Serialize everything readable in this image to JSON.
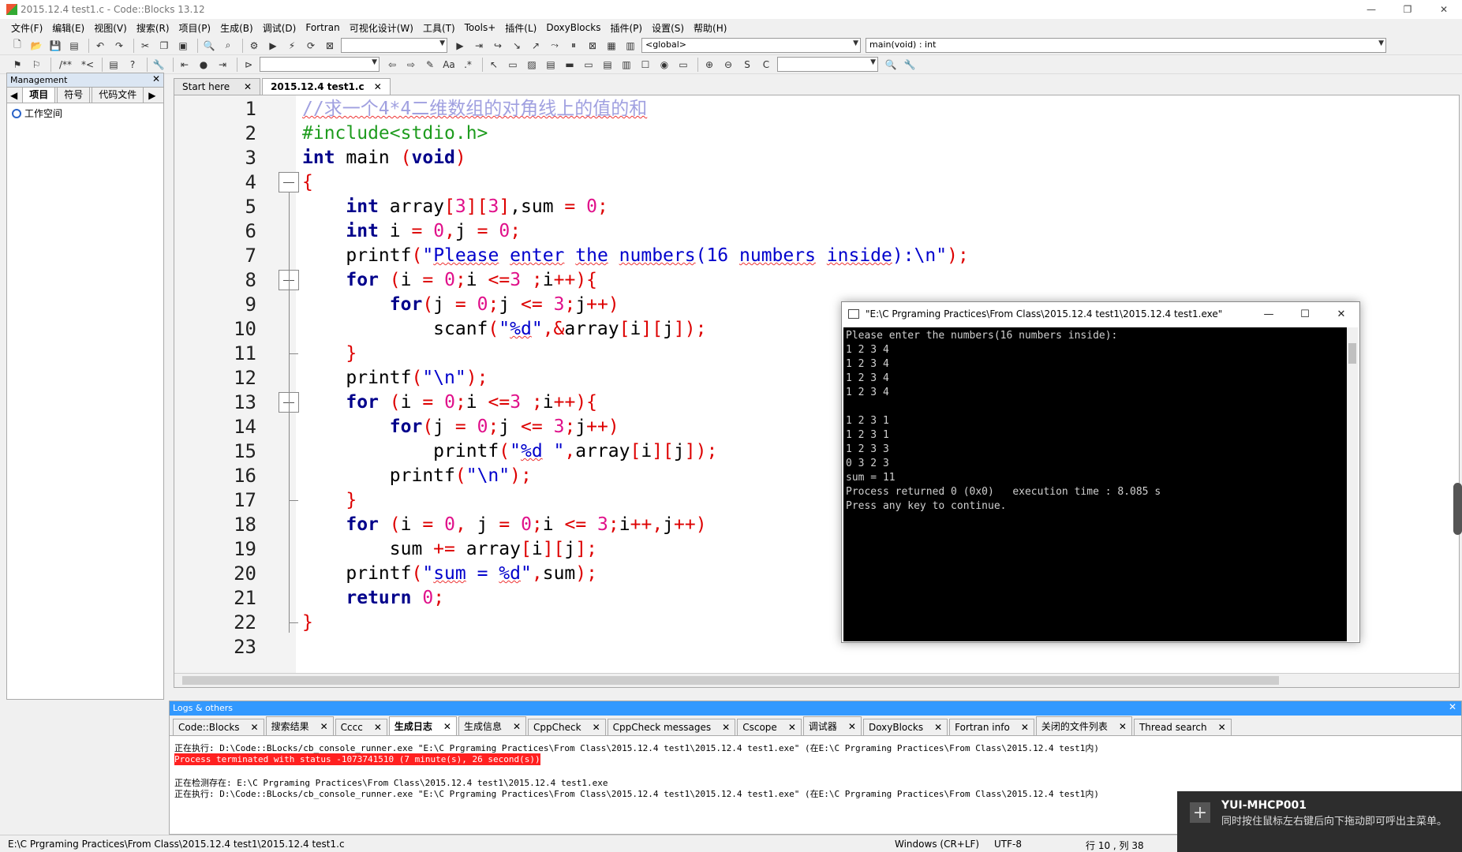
{
  "window": {
    "title": "2015.12.4 test1.c - Code::Blocks 13.12",
    "controls": [
      "—",
      "❐",
      "✕"
    ]
  },
  "menu": [
    "文件(F)",
    "编辑(E)",
    "视图(V)",
    "搜索(R)",
    "项目(P)",
    "生成(B)",
    "调试(D)",
    "Fortran",
    "可视化设计(W)",
    "工具(T)",
    "Tools+",
    "插件(L)",
    "DoxyBlocks",
    "插件(P)",
    "设置(S)",
    "帮助(H)"
  ],
  "toolbar": {
    "scope_combo": "<global>",
    "function_combo": "main(void) : int"
  },
  "management": {
    "title": "Management",
    "tabs": [
      "项目",
      "符号",
      "代码文件"
    ],
    "tree_root": "工作空间"
  },
  "editor_tabs": [
    "Start here",
    "2015.12.4 test1.c"
  ],
  "code_lines": [
    {
      "n": "1",
      "html": "<span class=\"cm u\">//求一个4*4二维数组的对角线上的值的和</span>"
    },
    {
      "n": "2",
      "html": "<span class=\"pp\">#include&lt;stdio.h&gt;</span>"
    },
    {
      "n": "3",
      "html": "<span class=\"kw\">int</span> main <span class=\"op\">(</span><span class=\"kw\">void</span><span class=\"op\">)</span>"
    },
    {
      "n": "4",
      "html": "<span class=\"op\">{</span>"
    },
    {
      "n": "5",
      "html": "    <span class=\"kw\">int</span> array<span class=\"op\">[</span><span class=\"num\">3</span><span class=\"op\">][</span><span class=\"num\">3</span><span class=\"op\">]</span>,sum <span class=\"op\">=</span> <span class=\"num\">0</span><span class=\"op\">;</span>"
    },
    {
      "n": "6",
      "html": "    <span class=\"kw\">int</span> i <span class=\"op\">=</span> <span class=\"num\">0</span><span class=\"op\">,</span>j <span class=\"op\">=</span> <span class=\"num\">0</span><span class=\"op\">;</span>"
    },
    {
      "n": "7",
      "html": "    printf<span class=\"op\">(</span><span class=\"str\">\"<span class=\"u\">Please</span> <span class=\"u\">enter</span> <span class=\"u\">the</span> <span class=\"u\">numbers</span>(16 <span class=\"u\">numbers</span> <span class=\"u\">inside</span>):\\n\"</span><span class=\"op\">);</span>"
    },
    {
      "n": "8",
      "html": "    <span class=\"kw\">for</span> <span class=\"op\">(</span>i <span class=\"op\">=</span> <span class=\"num\">0</span><span class=\"op\">;</span>i <span class=\"op\">&lt;=</span><span class=\"num\">3</span> <span class=\"op\">;</span>i<span class=\"op\">++){</span>"
    },
    {
      "n": "9",
      "html": "        <span class=\"kw\">for</span><span class=\"op\">(</span>j <span class=\"op\">=</span> <span class=\"num\">0</span><span class=\"op\">;</span>j <span class=\"op\">&lt;=</span> <span class=\"num\">3</span><span class=\"op\">;</span>j<span class=\"op\">++)</span>"
    },
    {
      "n": "10",
      "html": "            scanf<span class=\"op\">(</span><span class=\"str\">\"<span class=\"u\">%d</span>\"</span><span class=\"op\">,&amp;</span>array<span class=\"op\">[</span>i<span class=\"op\">][</span>j<span class=\"op\">]);</span>"
    },
    {
      "n": "11",
      "html": "    <span class=\"op\">}</span>"
    },
    {
      "n": "12",
      "html": "    printf<span class=\"op\">(</span><span class=\"str\">\"\\n\"</span><span class=\"op\">);</span>"
    },
    {
      "n": "13",
      "html": "    <span class=\"kw\">for</span> <span class=\"op\">(</span>i <span class=\"op\">=</span> <span class=\"num\">0</span><span class=\"op\">;</span>i <span class=\"op\">&lt;=</span><span class=\"num\">3</span> <span class=\"op\">;</span>i<span class=\"op\">++){</span>"
    },
    {
      "n": "14",
      "html": "        <span class=\"kw\">for</span><span class=\"op\">(</span>j <span class=\"op\">=</span> <span class=\"num\">0</span><span class=\"op\">;</span>j <span class=\"op\">&lt;=</span> <span class=\"num\">3</span><span class=\"op\">;</span>j<span class=\"op\">++)</span>"
    },
    {
      "n": "15",
      "html": "            printf<span class=\"op\">(</span><span class=\"str\">\"<span class=\"u\">%d</span> \"</span><span class=\"op\">,</span>array<span class=\"op\">[</span>i<span class=\"op\">][</span>j<span class=\"op\">]);</span>"
    },
    {
      "n": "16",
      "html": "        printf<span class=\"op\">(</span><span class=\"str\">\"\\n\"</span><span class=\"op\">);</span>"
    },
    {
      "n": "17",
      "html": "    <span class=\"op\">}</span>"
    },
    {
      "n": "18",
      "html": "    <span class=\"kw\">for</span> <span class=\"op\">(</span>i <span class=\"op\">=</span> <span class=\"num\">0</span><span class=\"op\">,</span> j <span class=\"op\">=</span> <span class=\"num\">0</span><span class=\"op\">;</span>i <span class=\"op\">&lt;=</span> <span class=\"num\">3</span><span class=\"op\">;</span>i<span class=\"op\">++,</span>j<span class=\"op\">++)</span>"
    },
    {
      "n": "19",
      "html": "        sum <span class=\"op\">+=</span> array<span class=\"op\">[</span>i<span class=\"op\">][</span>j<span class=\"op\">];</span>"
    },
    {
      "n": "20",
      "html": "    printf<span class=\"op\">(</span><span class=\"str\">\"<span class=\"u\">sum</span> = <span class=\"u\">%d</span>\"</span><span class=\"op\">,</span>sum<span class=\"op\">);</span>"
    },
    {
      "n": "21",
      "html": "    <span class=\"kw\">return</span> <span class=\"num\">0</span><span class=\"op\">;</span>"
    },
    {
      "n": "22",
      "html": "<span class=\"op\">}</span>"
    },
    {
      "n": "23",
      "html": ""
    }
  ],
  "console": {
    "title": "\"E:\\C Prgraming Practices\\From Class\\2015.12.4 test1\\2015.12.4 test1.exe\"",
    "lines": [
      "Please enter the numbers(16 numbers inside):",
      "1 2 3 4",
      "1 2 3 4",
      "1 2 3 4",
      "1 2 3 4",
      "",
      "1 2 3 1",
      "1 2 3 1",
      "1 2 3 3",
      "0 3 2 3",
      "sum = 11",
      "Process returned 0 (0x0)   execution time : 8.085 s",
      "Press any key to continue."
    ]
  },
  "logs": {
    "title": "Logs & others",
    "tabs": [
      "Code::Blocks",
      "搜索结果",
      "Cccc",
      "生成日志",
      "生成信息",
      "CppCheck",
      "CppCheck messages",
      "Cscope",
      "调试器",
      "DoxyBlocks",
      "Fortran info",
      "关闭的文件列表",
      "Thread search"
    ],
    "lines": [
      "正在执行: D:\\Code::BLocks/cb_console_runner.exe \"E:\\C Prgraming Practices\\From Class\\2015.12.4 test1\\2015.12.4 test1.exe\" (在E:\\C Prgraming Practices\\From Class\\2015.12.4 test1内)",
      "Process terminated with status -1073741510 (7 minute(s), 26 second(s))",
      "",
      "正在检测存在: E:\\C Prgraming Practices\\From Class\\2015.12.4 test1\\2015.12.4 test1.exe",
      "正在执行: D:\\Code::BLocks/cb_console_runner.exe \"E:\\C Prgraming Practices\\From Class\\2015.12.4 test1\\2015.12.4 test1.exe\" (在E:\\C Prgraming Practices\\From Class\\2015.12.4 test1内)"
    ]
  },
  "status": {
    "path": "E:\\C Prgraming Practices\\From Class\\2015.12.4 test1\\2015.12.4 test1.c",
    "line_endings": "Windows (CR+LF)",
    "encoding": "UTF-8",
    "position": "行 10 , 列 38"
  },
  "notification": {
    "title": "YUI-MHCP001",
    "body": "同时按住鼠标左右键后向下拖动即可呼出主菜单。"
  }
}
